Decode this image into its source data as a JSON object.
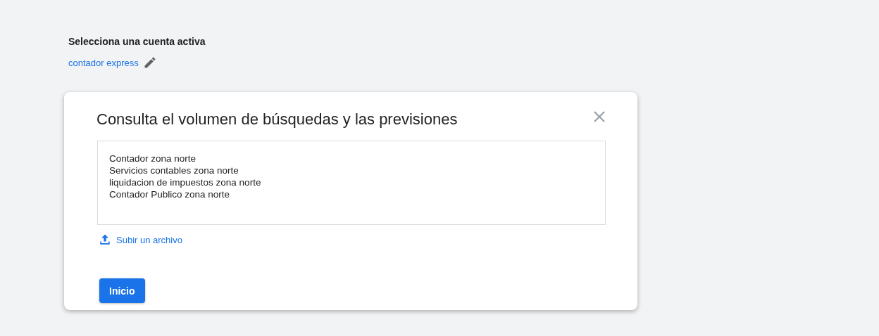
{
  "account": {
    "heading": "Selecciona una cuenta activa",
    "name": "contador express"
  },
  "dialog": {
    "title": "Consulta el volumen de búsquedas y las previsiones",
    "keywords": {
      "value": "Contador zona norte\nServicios contables zona norte\nliquidacion de impuestos zona norte\nContador Publico zona norte"
    },
    "upload_link": "Subir un archivo",
    "start_button": "Inicio"
  }
}
